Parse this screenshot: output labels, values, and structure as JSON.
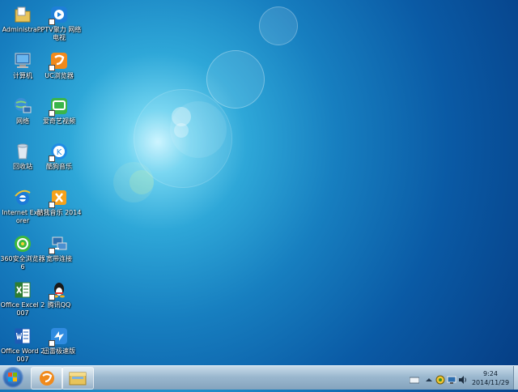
{
  "desktop": {
    "icons": [
      {
        "name": "administrator-folder-icon",
        "label": "Administra..."
      },
      {
        "name": "pptv-icon",
        "label": "PPTV聚力 网络电视"
      },
      {
        "name": "computer-icon",
        "label": "计算机"
      },
      {
        "name": "uc-browser-icon",
        "label": "UC浏览器"
      },
      {
        "name": "network-icon",
        "label": "网络"
      },
      {
        "name": "iqiyi-icon",
        "label": "爱奇艺视频"
      },
      {
        "name": "recycle-bin-icon",
        "label": "回收站"
      },
      {
        "name": "kugou-music-icon",
        "label": "酷狗音乐"
      },
      {
        "name": "internet-explorer-icon",
        "label": "Internet Explorer"
      },
      {
        "name": "kuwo-music-icon",
        "label": "酷我音乐 2014"
      },
      {
        "name": "360-browser-icon",
        "label": "360安全浏览器6"
      },
      {
        "name": "broadband-connect-icon",
        "label": "宽带连接"
      },
      {
        "name": "excel-icon",
        "label": "Office Excel 2007"
      },
      {
        "name": "qq-icon",
        "label": "腾讯QQ"
      },
      {
        "name": "word-icon",
        "label": "Office Word 2007"
      },
      {
        "name": "thunder-icon",
        "label": "迅雷极速版"
      }
    ]
  },
  "taskbar": {
    "start": "start-orb-icon",
    "pinned": [
      "uc-browser-icon",
      "file-explorer-icon"
    ],
    "tray": {
      "time": "9:24",
      "date": "2014/11/29"
    }
  },
  "colors": {
    "wallpaper_center": "#c9f4ff",
    "wallpaper_edge": "#063f86",
    "taskbar": "#9bb8cf"
  }
}
